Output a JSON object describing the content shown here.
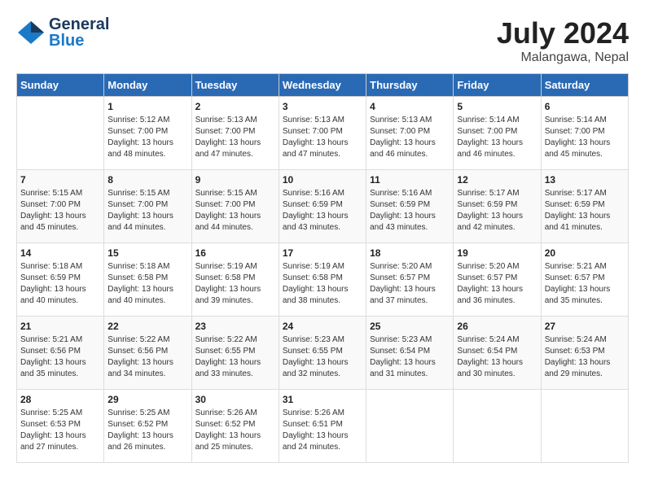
{
  "header": {
    "logo_general": "General",
    "logo_blue": "Blue",
    "month": "July 2024",
    "location": "Malangawa, Nepal"
  },
  "days_of_week": [
    "Sunday",
    "Monday",
    "Tuesday",
    "Wednesday",
    "Thursday",
    "Friday",
    "Saturday"
  ],
  "weeks": [
    [
      {
        "day": "",
        "info": ""
      },
      {
        "day": "1",
        "info": "Sunrise: 5:12 AM\nSunset: 7:00 PM\nDaylight: 13 hours\nand 48 minutes."
      },
      {
        "day": "2",
        "info": "Sunrise: 5:13 AM\nSunset: 7:00 PM\nDaylight: 13 hours\nand 47 minutes."
      },
      {
        "day": "3",
        "info": "Sunrise: 5:13 AM\nSunset: 7:00 PM\nDaylight: 13 hours\nand 47 minutes."
      },
      {
        "day": "4",
        "info": "Sunrise: 5:13 AM\nSunset: 7:00 PM\nDaylight: 13 hours\nand 46 minutes."
      },
      {
        "day": "5",
        "info": "Sunrise: 5:14 AM\nSunset: 7:00 PM\nDaylight: 13 hours\nand 46 minutes."
      },
      {
        "day": "6",
        "info": "Sunrise: 5:14 AM\nSunset: 7:00 PM\nDaylight: 13 hours\nand 45 minutes."
      }
    ],
    [
      {
        "day": "7",
        "info": "Sunrise: 5:15 AM\nSunset: 7:00 PM\nDaylight: 13 hours\nand 45 minutes."
      },
      {
        "day": "8",
        "info": "Sunrise: 5:15 AM\nSunset: 7:00 PM\nDaylight: 13 hours\nand 44 minutes."
      },
      {
        "day": "9",
        "info": "Sunrise: 5:15 AM\nSunset: 7:00 PM\nDaylight: 13 hours\nand 44 minutes."
      },
      {
        "day": "10",
        "info": "Sunrise: 5:16 AM\nSunset: 6:59 PM\nDaylight: 13 hours\nand 43 minutes."
      },
      {
        "day": "11",
        "info": "Sunrise: 5:16 AM\nSunset: 6:59 PM\nDaylight: 13 hours\nand 43 minutes."
      },
      {
        "day": "12",
        "info": "Sunrise: 5:17 AM\nSunset: 6:59 PM\nDaylight: 13 hours\nand 42 minutes."
      },
      {
        "day": "13",
        "info": "Sunrise: 5:17 AM\nSunset: 6:59 PM\nDaylight: 13 hours\nand 41 minutes."
      }
    ],
    [
      {
        "day": "14",
        "info": "Sunrise: 5:18 AM\nSunset: 6:59 PM\nDaylight: 13 hours\nand 40 minutes."
      },
      {
        "day": "15",
        "info": "Sunrise: 5:18 AM\nSunset: 6:58 PM\nDaylight: 13 hours\nand 40 minutes."
      },
      {
        "day": "16",
        "info": "Sunrise: 5:19 AM\nSunset: 6:58 PM\nDaylight: 13 hours\nand 39 minutes."
      },
      {
        "day": "17",
        "info": "Sunrise: 5:19 AM\nSunset: 6:58 PM\nDaylight: 13 hours\nand 38 minutes."
      },
      {
        "day": "18",
        "info": "Sunrise: 5:20 AM\nSunset: 6:57 PM\nDaylight: 13 hours\nand 37 minutes."
      },
      {
        "day": "19",
        "info": "Sunrise: 5:20 AM\nSunset: 6:57 PM\nDaylight: 13 hours\nand 36 minutes."
      },
      {
        "day": "20",
        "info": "Sunrise: 5:21 AM\nSunset: 6:57 PM\nDaylight: 13 hours\nand 35 minutes."
      }
    ],
    [
      {
        "day": "21",
        "info": "Sunrise: 5:21 AM\nSunset: 6:56 PM\nDaylight: 13 hours\nand 35 minutes."
      },
      {
        "day": "22",
        "info": "Sunrise: 5:22 AM\nSunset: 6:56 PM\nDaylight: 13 hours\nand 34 minutes."
      },
      {
        "day": "23",
        "info": "Sunrise: 5:22 AM\nSunset: 6:55 PM\nDaylight: 13 hours\nand 33 minutes."
      },
      {
        "day": "24",
        "info": "Sunrise: 5:23 AM\nSunset: 6:55 PM\nDaylight: 13 hours\nand 32 minutes."
      },
      {
        "day": "25",
        "info": "Sunrise: 5:23 AM\nSunset: 6:54 PM\nDaylight: 13 hours\nand 31 minutes."
      },
      {
        "day": "26",
        "info": "Sunrise: 5:24 AM\nSunset: 6:54 PM\nDaylight: 13 hours\nand 30 minutes."
      },
      {
        "day": "27",
        "info": "Sunrise: 5:24 AM\nSunset: 6:53 PM\nDaylight: 13 hours\nand 29 minutes."
      }
    ],
    [
      {
        "day": "28",
        "info": "Sunrise: 5:25 AM\nSunset: 6:53 PM\nDaylight: 13 hours\nand 27 minutes."
      },
      {
        "day": "29",
        "info": "Sunrise: 5:25 AM\nSunset: 6:52 PM\nDaylight: 13 hours\nand 26 minutes."
      },
      {
        "day": "30",
        "info": "Sunrise: 5:26 AM\nSunset: 6:52 PM\nDaylight: 13 hours\nand 25 minutes."
      },
      {
        "day": "31",
        "info": "Sunrise: 5:26 AM\nSunset: 6:51 PM\nDaylight: 13 hours\nand 24 minutes."
      },
      {
        "day": "",
        "info": ""
      },
      {
        "day": "",
        "info": ""
      },
      {
        "day": "",
        "info": ""
      }
    ]
  ]
}
